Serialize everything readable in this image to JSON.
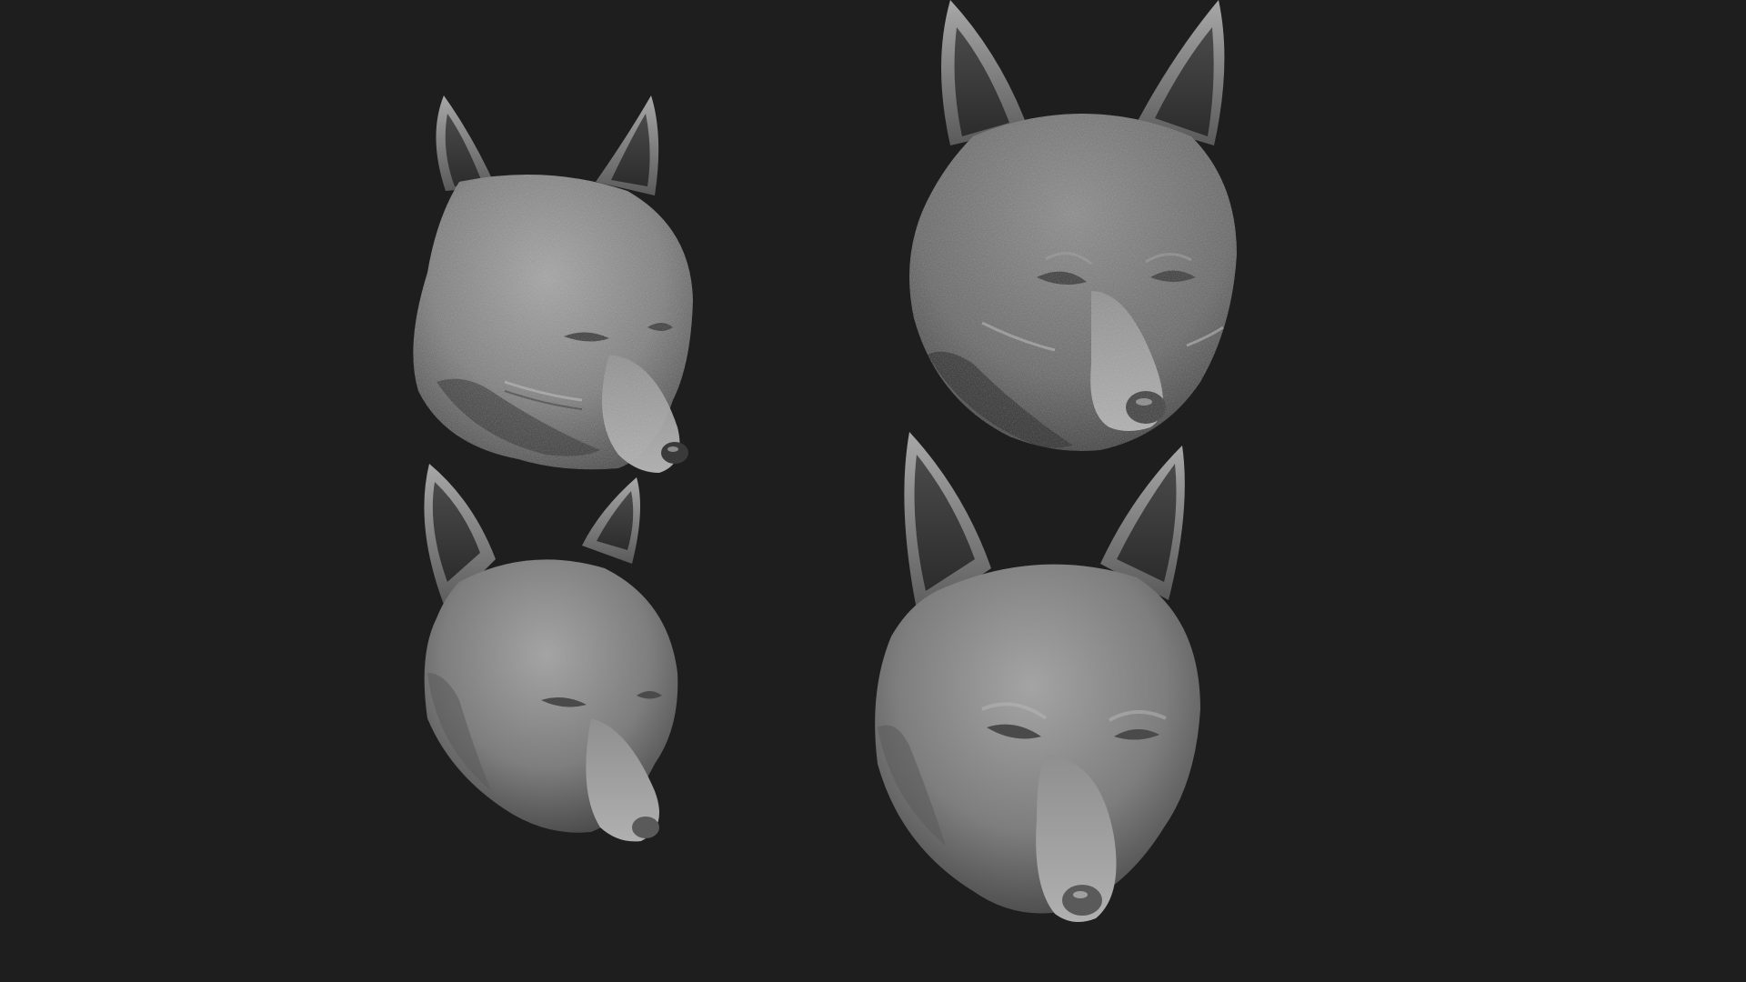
{
  "scene": {
    "background_color": "#1e1e1e",
    "material_color": "#8c8c8c",
    "sculpts": [
      {
        "name": "fox-head-sculpt-small-detailed",
        "detail": "fur-textured"
      },
      {
        "name": "fox-head-sculpt-large-detailed",
        "detail": "fur-textured"
      },
      {
        "name": "fox-head-sculpt-small-smooth",
        "detail": "smooth"
      },
      {
        "name": "fox-head-sculpt-large-smooth",
        "detail": "smooth"
      }
    ]
  }
}
